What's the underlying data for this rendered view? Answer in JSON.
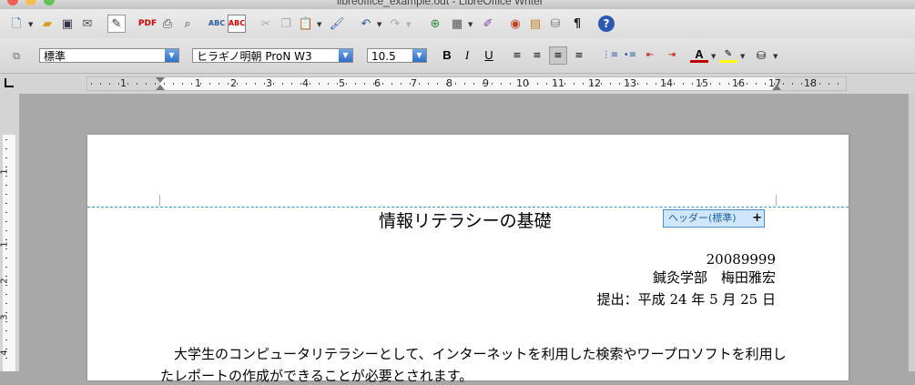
{
  "window": {
    "title": "libreoffice_example.odt - LibreOffice Writer"
  },
  "toolbar2": {
    "paragraph_style": "標準",
    "font_name": "ヒラギノ明朝 ProN W3",
    "font_size": "10.5",
    "bold_label": "B",
    "italic_label": "I",
    "underline_label": "U",
    "font_color_label": "A"
  },
  "colors": {
    "accent": "#2f6fc8",
    "header_boundary": "#3f8fc8",
    "font_color": "#c00000",
    "highlight": "#ffff00"
  },
  "ruler": {
    "h_numbers": [
      "1",
      "1",
      "2",
      "3",
      "4",
      "5",
      "6",
      "7",
      "8",
      "9",
      "10",
      "11",
      "12",
      "13",
      "14",
      "15",
      "16",
      "17",
      "18"
    ],
    "v_numbers": [
      "1",
      "1",
      "2",
      "3",
      "4"
    ]
  },
  "document": {
    "header_label": "ヘッダー(標準)",
    "header_plus": "+",
    "title": "情報リテラシーの基礎",
    "student_id": "20089999",
    "department_name": "鍼灸学部　梅田雅宏",
    "submitted": "提出：平成 24 年 5 月 25 日",
    "paragraph_line1": "　大学生のコンピュータリテラシーとして、インターネットを利用した検索やワープロソフトを利用し",
    "paragraph_line2": "たレポートの作成ができることが必要とされます。"
  }
}
